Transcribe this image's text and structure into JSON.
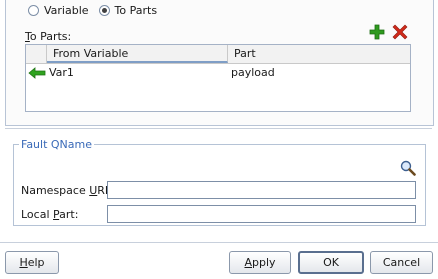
{
  "mode": {
    "options": [
      {
        "label": "Variable",
        "checked": false
      },
      {
        "label": "To Parts",
        "checked": true
      }
    ]
  },
  "to_parts": {
    "label_mnemonic": "T",
    "label_rest": "o Parts:",
    "add_icon": "add-icon",
    "delete_icon": "delete-icon",
    "table": {
      "columns": [
        "From Variable",
        "Part"
      ],
      "rows": [
        {
          "icon": "left-arrow-icon",
          "from_variable": "Var1",
          "part": "payload"
        }
      ]
    }
  },
  "fault_qname": {
    "legend": "Fault QName",
    "search_icon": "search-icon",
    "namespace_label_pre": "Namespace ",
    "namespace_label_mnemonic": "U",
    "namespace_label_post": "RI:",
    "namespace_value": "",
    "local_part_label_pre": "Local ",
    "local_part_label_mnemonic": "P",
    "local_part_label_post": "art:",
    "local_part_value": ""
  },
  "footer": {
    "help_mnemonic": "H",
    "help_rest": "elp",
    "apply_mnemonic": "A",
    "apply_rest": "pply",
    "ok_label": "OK",
    "cancel_label": "Cancel"
  },
  "colors": {
    "add_icon": "#2e9a1e",
    "delete_icon": "#d12a1a",
    "arrow": "#2fa31f",
    "legend_text": "#3a6ab8"
  }
}
